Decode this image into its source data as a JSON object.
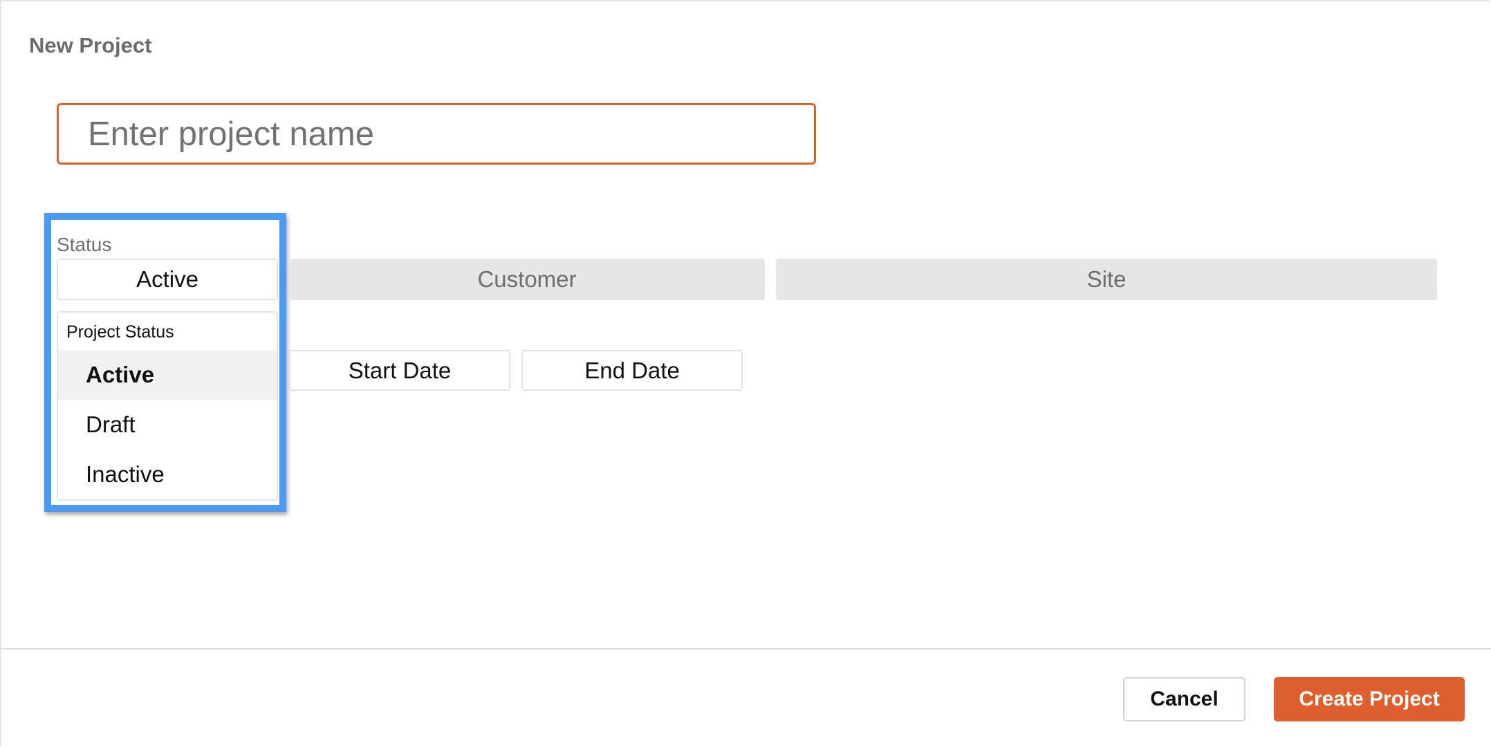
{
  "dialog": {
    "title": "New Project"
  },
  "project_name": {
    "value": "",
    "placeholder": "Enter project name"
  },
  "status": {
    "label": "Status",
    "selected": "Active",
    "menu_header": "Project Status",
    "options": [
      "Active",
      "Draft",
      "Inactive"
    ],
    "highlight_color": "#4a9af2"
  },
  "fields": {
    "customer": "Customer",
    "site": "Site",
    "start_date": "Start Date",
    "end_date": "End Date"
  },
  "footer": {
    "cancel_label": "Cancel",
    "create_label": "Create Project",
    "accent_color": "#dd5f2e"
  }
}
